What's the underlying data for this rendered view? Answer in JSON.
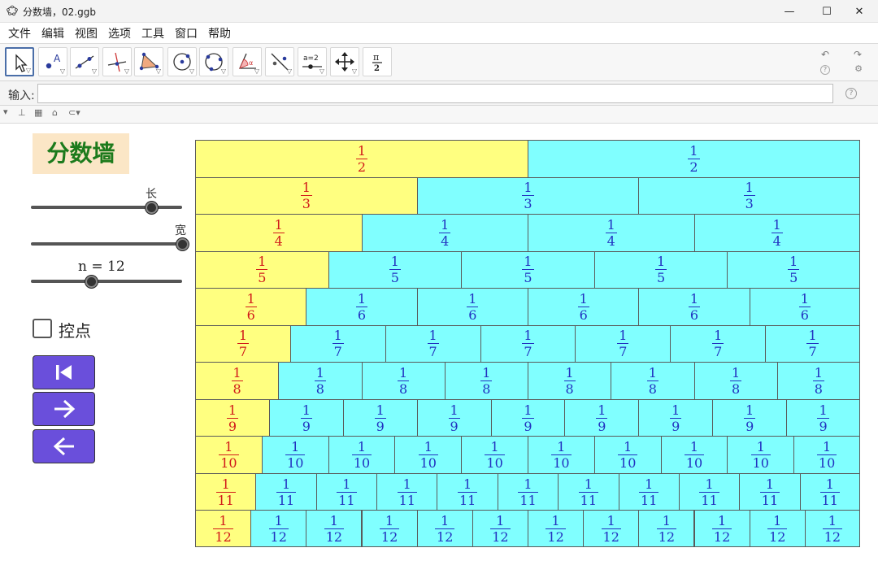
{
  "window": {
    "title": "分数墙，02.ggb",
    "minimize_glyph": "—",
    "maximize_glyph": "☐",
    "close_glyph": "✕"
  },
  "menu": [
    "文件",
    "编辑",
    "视图",
    "选项",
    "工具",
    "窗口",
    "帮助"
  ],
  "toolbar": {
    "tools": [
      {
        "name": "move-tool-icon",
        "selected": true
      },
      {
        "name": "point-tool-icon"
      },
      {
        "name": "line-tool-icon"
      },
      {
        "name": "perpendicular-line-tool-icon"
      },
      {
        "name": "polygon-tool-icon"
      },
      {
        "name": "circle-center-point-tool-icon"
      },
      {
        "name": "circle-three-points-tool-icon"
      },
      {
        "name": "angle-tool-icon"
      },
      {
        "name": "reflect-tool-icon"
      },
      {
        "name": "slider-tool-icon",
        "label": "a=2"
      },
      {
        "name": "move-graphics-view-tool-icon"
      },
      {
        "name": "pi-tool-icon",
        "label_num": "π",
        "label_den": "2"
      }
    ],
    "undo_glyph": "↶",
    "redo_glyph": "↷",
    "help_glyph": "?",
    "settings_glyph": "⚙"
  },
  "input_bar": {
    "label": "输入:",
    "value": "",
    "help_glyph": "?"
  },
  "canvas": {
    "title": "分数墙",
    "sliders": [
      {
        "label": "长",
        "value_fraction": 0.8
      },
      {
        "label": "宽",
        "value_fraction": 1.0
      },
      {
        "label": "n = 12",
        "value_fraction": 0.4
      }
    ],
    "checkbox": {
      "label": "控点",
      "checked": false
    },
    "buttons": [
      {
        "name": "first-step-button",
        "icon": "skip-to-start-icon"
      },
      {
        "name": "next-step-button",
        "icon": "arrow-right-icon"
      },
      {
        "name": "previous-step-button",
        "icon": "arrow-left-icon"
      }
    ]
  },
  "fraction_wall": {
    "rows": [
      2,
      3,
      4,
      5,
      6,
      7,
      8,
      9,
      10,
      11,
      12
    ],
    "numerator": "1",
    "highlight_color": "#ffff80",
    "base_color": "#80ffff",
    "highlight_text_color": "#d11a1a",
    "base_text_color": "#2232c0"
  }
}
